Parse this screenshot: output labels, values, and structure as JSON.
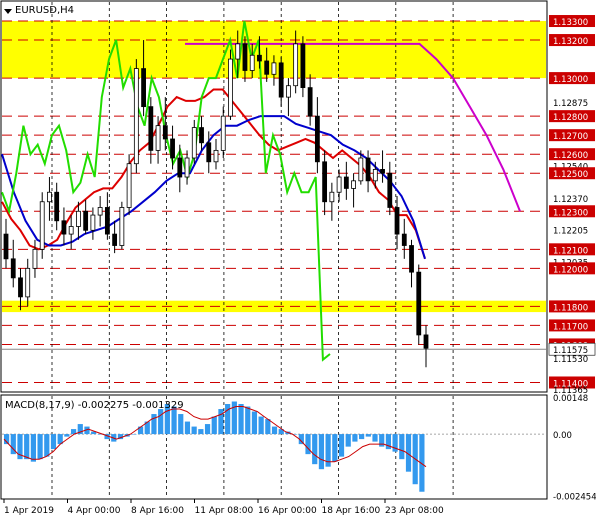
{
  "chart_data": [
    {
      "type": "candlestick",
      "title": "EURUSD,H4",
      "x_ticks": [
        "1 Apr 2019",
        "4 Apr 00:00",
        "8 Apr 16:00",
        "11 Apr 08:00",
        "16 Apr 00:00",
        "18 Apr 16:00",
        "23 Apr 08:00"
      ],
      "y_ticks": [
        "1.13300",
        "1.13200",
        "1.13000",
        "1.12875",
        "1.12800",
        "1.12700",
        "1.12600",
        "1.12540",
        "1.12500",
        "1.12370",
        "1.12300",
        "1.12205",
        "1.12100",
        "1.12035",
        "1.12000",
        "1.11800",
        "1.11700",
        "1.11600",
        "1.11530",
        "1.11400",
        "1.11365"
      ],
      "level_labels": [
        "1.13300",
        "1.13200",
        "1.13000",
        "1.12800",
        "1.12700",
        "1.12600",
        "1.12500",
        "1.12300",
        "1.12100",
        "1.12000",
        "1.11800",
        "1.11700",
        "1.11600",
        "1.11400"
      ],
      "current_price": "1.11575",
      "ylim": [
        1.1135,
        1.134
      ],
      "resistance_zone": [
        1.13,
        1.133
      ],
      "support_zone": [
        1.1177,
        1.1183
      ],
      "ohlc": [
        [
          1.1218,
          1.1226,
          1.12,
          1.1205
        ],
        [
          1.1205,
          1.1215,
          1.119,
          1.1195
        ],
        [
          1.1195,
          1.12,
          1.1178,
          1.1185
        ],
        [
          1.1185,
          1.1205,
          1.118,
          1.12
        ],
        [
          1.12,
          1.1215,
          1.1195,
          1.121
        ],
        [
          1.121,
          1.124,
          1.1205,
          1.1235
        ],
        [
          1.1235,
          1.1248,
          1.1225,
          1.124
        ],
        [
          1.124,
          1.1245,
          1.122,
          1.1225
        ],
        [
          1.1225,
          1.1232,
          1.1212,
          1.1218
        ],
        [
          1.1218,
          1.1228,
          1.121,
          1.1222
        ],
        [
          1.1222,
          1.1235,
          1.1215,
          1.123
        ],
        [
          1.123,
          1.1236,
          1.1218,
          1.122
        ],
        [
          1.122,
          1.1232,
          1.1215,
          1.1228
        ],
        [
          1.1228,
          1.1238,
          1.1222,
          1.1232
        ],
        [
          1.1232,
          1.124,
          1.1215,
          1.1218
        ],
        [
          1.1218,
          1.1225,
          1.1208,
          1.1212
        ],
        [
          1.1212,
          1.1235,
          1.121,
          1.1232
        ],
        [
          1.1232,
          1.126,
          1.1228,
          1.1255
        ],
        [
          1.1255,
          1.131,
          1.125,
          1.1305
        ],
        [
          1.1305,
          1.132,
          1.128,
          1.1285
        ],
        [
          1.1285,
          1.129,
          1.1255,
          1.1262
        ],
        [
          1.1262,
          1.128,
          1.1255,
          1.1275
        ],
        [
          1.1275,
          1.129,
          1.1262,
          1.1268
        ],
        [
          1.1268,
          1.1275,
          1.1252,
          1.1258
        ],
        [
          1.1258,
          1.1265,
          1.124,
          1.1248
        ],
        [
          1.1248,
          1.1262,
          1.1244,
          1.1258
        ],
        [
          1.1258,
          1.1278,
          1.1255,
          1.1274
        ],
        [
          1.1274,
          1.128,
          1.1262,
          1.1266
        ],
        [
          1.1266,
          1.1272,
          1.125,
          1.1256
        ],
        [
          1.1256,
          1.1268,
          1.1252,
          1.1262
        ],
        [
          1.1262,
          1.1285,
          1.1258,
          1.128
        ],
        [
          1.128,
          1.1315,
          1.1278,
          1.131
        ],
        [
          1.131,
          1.1325,
          1.13,
          1.1318
        ],
        [
          1.1318,
          1.1322,
          1.1298,
          1.1304
        ],
        [
          1.1304,
          1.1318,
          1.13,
          1.1312
        ],
        [
          1.1312,
          1.1322,
          1.1305,
          1.1309
        ],
        [
          1.1309,
          1.1316,
          1.1298,
          1.1302
        ],
        [
          1.1302,
          1.1312,
          1.1296,
          1.1308
        ],
        [
          1.1308,
          1.1311,
          1.1285,
          1.129
        ],
        [
          1.129,
          1.13,
          1.128,
          1.1296
        ],
        [
          1.1296,
          1.1325,
          1.1292,
          1.1318
        ],
        [
          1.1318,
          1.1322,
          1.129,
          1.1295
        ],
        [
          1.1295,
          1.1302,
          1.1275,
          1.128
        ],
        [
          1.128,
          1.129,
          1.125,
          1.1256
        ],
        [
          1.1256,
          1.1262,
          1.1228,
          1.1235
        ],
        [
          1.1235,
          1.1245,
          1.1225,
          1.124
        ],
        [
          1.124,
          1.1252,
          1.1235,
          1.1248
        ],
        [
          1.1248,
          1.1256,
          1.1236,
          1.1242
        ],
        [
          1.1242,
          1.125,
          1.1232,
          1.1246
        ],
        [
          1.1246,
          1.1262,
          1.1244,
          1.1258
        ],
        [
          1.1258,
          1.1262,
          1.124,
          1.1246
        ],
        [
          1.1246,
          1.1256,
          1.1242,
          1.1252
        ],
        [
          1.1252,
          1.1262,
          1.1245,
          1.125
        ],
        [
          1.125,
          1.1256,
          1.1228,
          1.1232
        ],
        [
          1.1232,
          1.1238,
          1.121,
          1.1218
        ],
        [
          1.1218,
          1.1226,
          1.1205,
          1.1212
        ],
        [
          1.1212,
          1.1215,
          1.119,
          1.1198
        ],
        [
          1.1198,
          1.1202,
          1.116,
          1.1165
        ],
        [
          1.1165,
          1.117,
          1.1148,
          1.1158
        ]
      ],
      "lines": [
        {
          "color": "#dd0000",
          "values": [
            1.1235,
            1.1226,
            1.122,
            1.1212,
            1.121,
            1.1212,
            1.1215,
            1.1224,
            1.1232,
            1.1236,
            1.124,
            1.1242,
            1.1242,
            1.1248,
            1.1256,
            1.1262,
            1.1266,
            1.1275,
            1.1285,
            1.129,
            1.1288,
            1.1288,
            1.129,
            1.1294,
            1.1294,
            1.1288,
            1.1282,
            1.1276,
            1.127,
            1.1265,
            1.1262,
            1.1264,
            1.1266,
            1.1268,
            1.1266,
            1.1262,
            1.1258,
            1.1262,
            1.1258,
            1.1254,
            1.1248,
            1.124,
            1.1236,
            1.1228,
            1.1228,
            1.122,
            1.1205
          ]
        },
        {
          "color": "#0000cc",
          "values": [
            1.126,
            1.124,
            1.1225,
            1.1215,
            1.1212,
            1.1212,
            1.1214,
            1.1218,
            1.122,
            1.1222,
            1.1226,
            1.123,
            1.1235,
            1.124,
            1.1246,
            1.125,
            1.125,
            1.1262,
            1.127,
            1.1275,
            1.1275,
            1.1278,
            1.128,
            1.128,
            1.128,
            1.1276,
            1.1274,
            1.1272,
            1.127,
            1.1265,
            1.1262,
            1.1258,
            1.1252,
            1.1246,
            1.1238,
            1.1225,
            1.1205
          ]
        },
        {
          "color": "#cc00cc",
          "values": [
            1.1318,
            1.1318,
            1.1318,
            1.1318,
            1.1318,
            1.1318,
            1.1318,
            1.1318,
            1.1318,
            1.1318,
            1.1318,
            1.1318,
            1.1318,
            1.1318,
            1.1318,
            1.131,
            1.13,
            1.1285,
            1.127,
            1.1252,
            1.123
          ]
        },
        {
          "color": "#22dd00",
          "values": [
            1.124,
            1.123,
            1.125,
            1.1275,
            1.126,
            1.1265,
            1.1255,
            1.127,
            1.1275,
            1.1262,
            1.124,
            1.1245,
            1.126,
            1.1248,
            1.129,
            1.131,
            1.132,
            1.1295,
            1.1305,
            1.1285,
            1.1275,
            1.13,
            1.129,
            1.127,
            1.1255,
            1.1262,
            1.1248,
            1.126,
            1.129,
            1.13,
            1.13,
            1.131,
            1.132,
            1.13,
            1.133,
            1.131,
            1.132,
            1.125,
            1.127,
            1.126,
            1.124,
            1.125,
            1.124,
            1.124,
            1.1248,
            1.1152,
            1.1155
          ]
        }
      ]
    },
    {
      "type": "bar",
      "title": "MACD(8,17,9) -0.002275 -0.001329",
      "y_ticks": [
        "0.00148",
        "0.00",
        "-0.002454"
      ],
      "ylim": [
        -0.00255,
        0.00152
      ],
      "values": [
        -0.0004,
        -0.0008,
        -0.001,
        -0.001,
        -0.0011,
        -0.001,
        -0.0009,
        -0.0006,
        -0.0004,
        -0.0001,
        0.0002,
        0.0004,
        0.0003,
        0.0001,
        0.0,
        -0.0002,
        -0.0003,
        -0.0002,
        -0.0001,
        0.0,
        0.0003,
        0.0005,
        0.0008,
        0.001,
        0.0012,
        0.0011,
        0.0008,
        0.0005,
        0.0003,
        0.0002,
        0.0004,
        0.0007,
        0.001,
        0.0012,
        0.0013,
        0.0012,
        0.0011,
        0.0009,
        0.0007,
        0.0006,
        0.0003,
        0.0002,
        0.0001,
        0.0,
        -0.0004,
        -0.0008,
        -0.0012,
        -0.0014,
        -0.0013,
        -0.0011,
        -0.0009,
        -0.0005,
        -0.0003,
        -0.0002,
        -0.0001,
        -0.0003,
        -0.0005,
        -0.0006,
        -0.0007,
        -0.001,
        -0.0015,
        -0.002,
        -0.0023
      ],
      "signal": [
        -0.0002,
        -0.0005,
        -0.0008,
        -0.0009,
        -0.001,
        -0.001,
        -0.0009,
        -0.0007,
        -0.0004,
        -0.0002,
        0.0,
        0.0001,
        0.0002,
        0.0001,
        0.0,
        -0.0001,
        -0.0002,
        -0.0001,
        0.0,
        0.0002,
        0.0004,
        0.0006,
        0.0007,
        0.0009,
        0.001,
        0.001,
        0.0009,
        0.0007,
        0.0006,
        0.0006,
        0.0007,
        0.0008,
        0.001,
        0.0011,
        0.0011,
        0.001,
        0.0009,
        0.0007,
        0.0005,
        0.0003,
        0.0001,
        0.0,
        -0.0002,
        -0.0005,
        -0.0008,
        -0.001,
        -0.0011,
        -0.0011,
        -0.001,
        -0.0009,
        -0.0007,
        -0.0005,
        -0.0004,
        -0.0004,
        -0.0004,
        -0.0005,
        -0.0006,
        -0.0007,
        -0.0009,
        -0.0011,
        -0.0013
      ]
    }
  ]
}
